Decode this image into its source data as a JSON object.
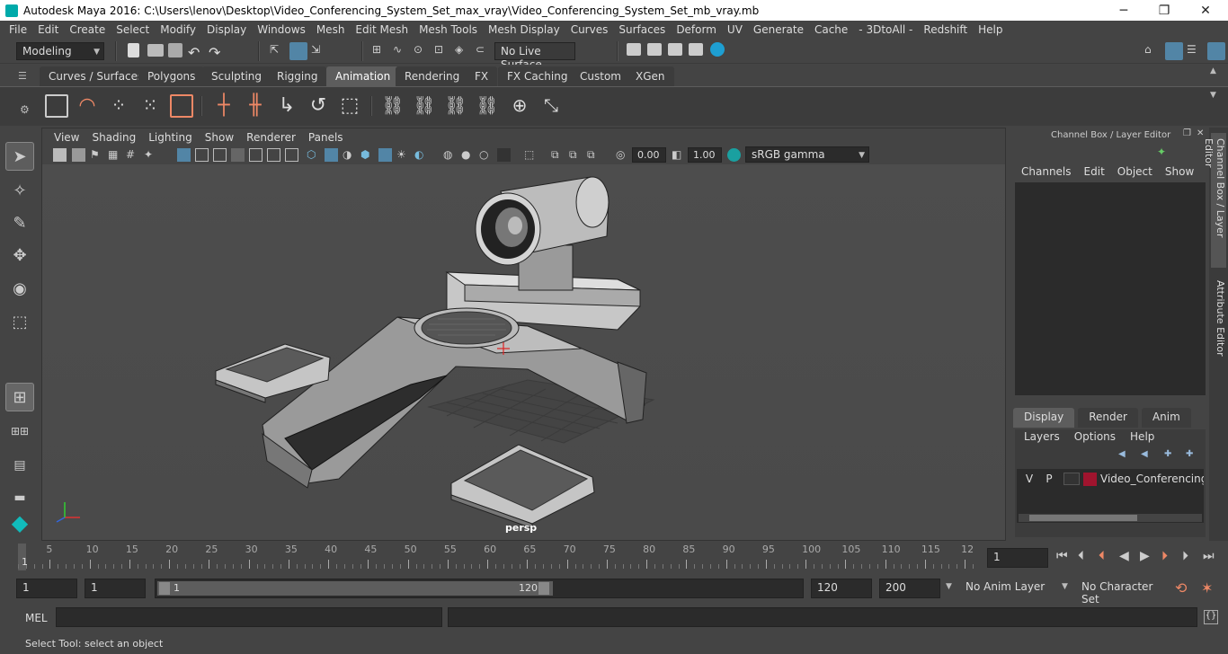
{
  "window": {
    "title": "Autodesk Maya 2016: C:\\Users\\lenov\\Desktop\\Video_Conferencing_System_Set_max_vray\\Video_Conferencing_System_Set_mb_vray.mb",
    "minimize": "─",
    "restore": "❐",
    "close": "✕"
  },
  "menubar": [
    "File",
    "Edit",
    "Create",
    "Select",
    "Modify",
    "Display",
    "Windows",
    "Mesh",
    "Edit Mesh",
    "Mesh Tools",
    "Mesh Display",
    "Curves",
    "Surfaces",
    "Deform",
    "UV",
    "Generate",
    "Cache",
    "- 3DtoAll -",
    "Redshift",
    "Help"
  ],
  "statusline": {
    "mode": "Modeling",
    "live_surface": "No Live Surface"
  },
  "shelf_tabs": [
    "Curves / Surfaces",
    "Polygons",
    "Sculpting",
    "Rigging",
    "Animation",
    "Rendering",
    "FX",
    "FX Caching",
    "Custom",
    "XGen"
  ],
  "active_shelf_tab": "Animation",
  "panel_menu": [
    "View",
    "Shading",
    "Lighting",
    "Show",
    "Renderer",
    "Panels"
  ],
  "panel_toolbar": {
    "exposure": "0.00",
    "gamma": "1.00",
    "color_space": "sRGB gamma"
  },
  "viewport": {
    "camera_label": "persp"
  },
  "channel_box": {
    "title": "Channel Box / Layer Editor",
    "menu": [
      "Channels",
      "Edit",
      "Object",
      "Show"
    ]
  },
  "layer_editor": {
    "tabs": [
      "Display",
      "Render",
      "Anim"
    ],
    "active_tab": "Display",
    "menu": [
      "Layers",
      "Options",
      "Help"
    ],
    "layers": [
      {
        "v": "V",
        "p": "P",
        "name": "Video_Conferencing_S",
        "color": "#a0142e"
      }
    ]
  },
  "side_tabs": [
    "Channel Box / Layer Editor",
    "Attribute Editor"
  ],
  "timeline": {
    "labels": [
      "5",
      "10",
      "15",
      "20",
      "25",
      "30",
      "35",
      "40",
      "45",
      "50",
      "55",
      "60",
      "65",
      "70",
      "75",
      "80",
      "85",
      "90",
      "95",
      "100",
      "105",
      "110",
      "115",
      "12"
    ],
    "start_label": "1",
    "current_frame": "1"
  },
  "range": {
    "start": "1",
    "anim_start": "1",
    "slider_min": "1",
    "slider_max": "120",
    "end": "120",
    "anim_end": "200",
    "anim_layer": "No Anim Layer",
    "character_set": "No Character Set"
  },
  "mel": {
    "label": "MEL"
  },
  "help_line": "Select Tool: select an object",
  "colors": {
    "accent": "#5285a6",
    "panel_bg": "#444444",
    "field_bg": "#2b2b2b"
  }
}
